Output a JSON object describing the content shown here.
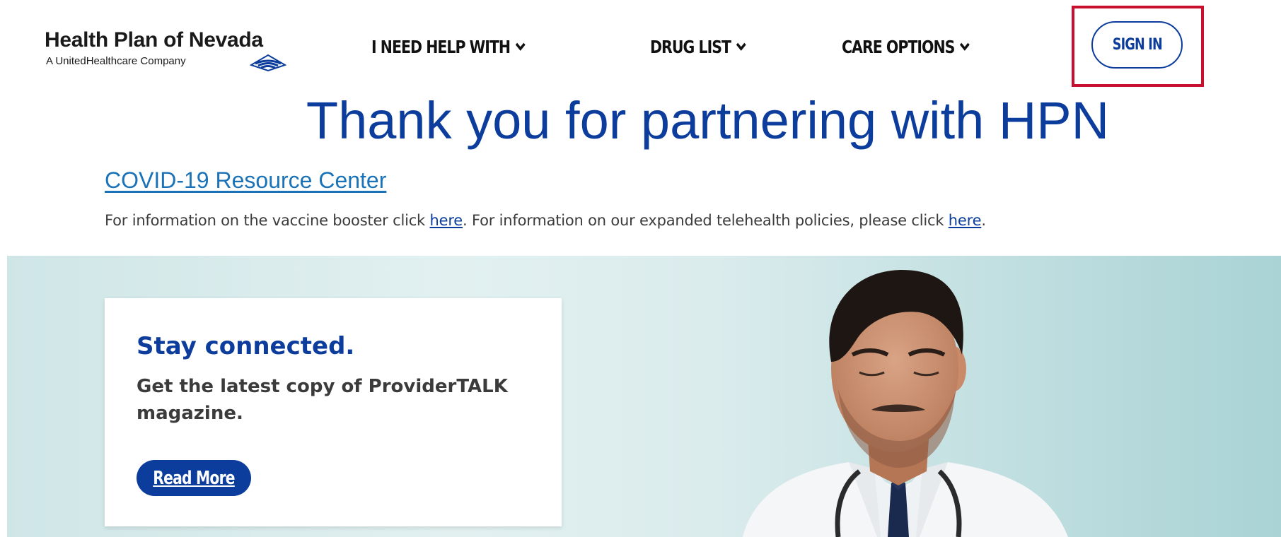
{
  "header": {
    "logo_title": "Health Plan of Nevada",
    "logo_subtitle": "A UnitedHealthcare Company",
    "nav": [
      {
        "label": "I NEED HELP WITH",
        "icon": "chevron-down-icon"
      },
      {
        "label": "DRUG LIST",
        "icon": "chevron-down-icon"
      },
      {
        "label": "CARE OPTIONS",
        "icon": "chevron-down-icon"
      }
    ],
    "sign_in_label": "SIGN IN"
  },
  "main": {
    "title": "Thank you for partnering with HPN",
    "covid_link": "COVID-19 Resource Center",
    "info": {
      "part1": "For information on the vaccine booster click ",
      "link1": "here",
      "part2": ". For information on our expanded telehealth policies, please click ",
      "link2": "here",
      "part3": "."
    }
  },
  "banner": {
    "card_title": "Stay connected.",
    "card_text": "Get the latest copy of ProviderTALK magazine.",
    "button_label": "Read More"
  },
  "colors": {
    "brand_blue": "#0c3d9c",
    "link_blue": "#1a73b8",
    "highlight_red": "#c8102e",
    "banner_teal": "#cfe6e7"
  }
}
